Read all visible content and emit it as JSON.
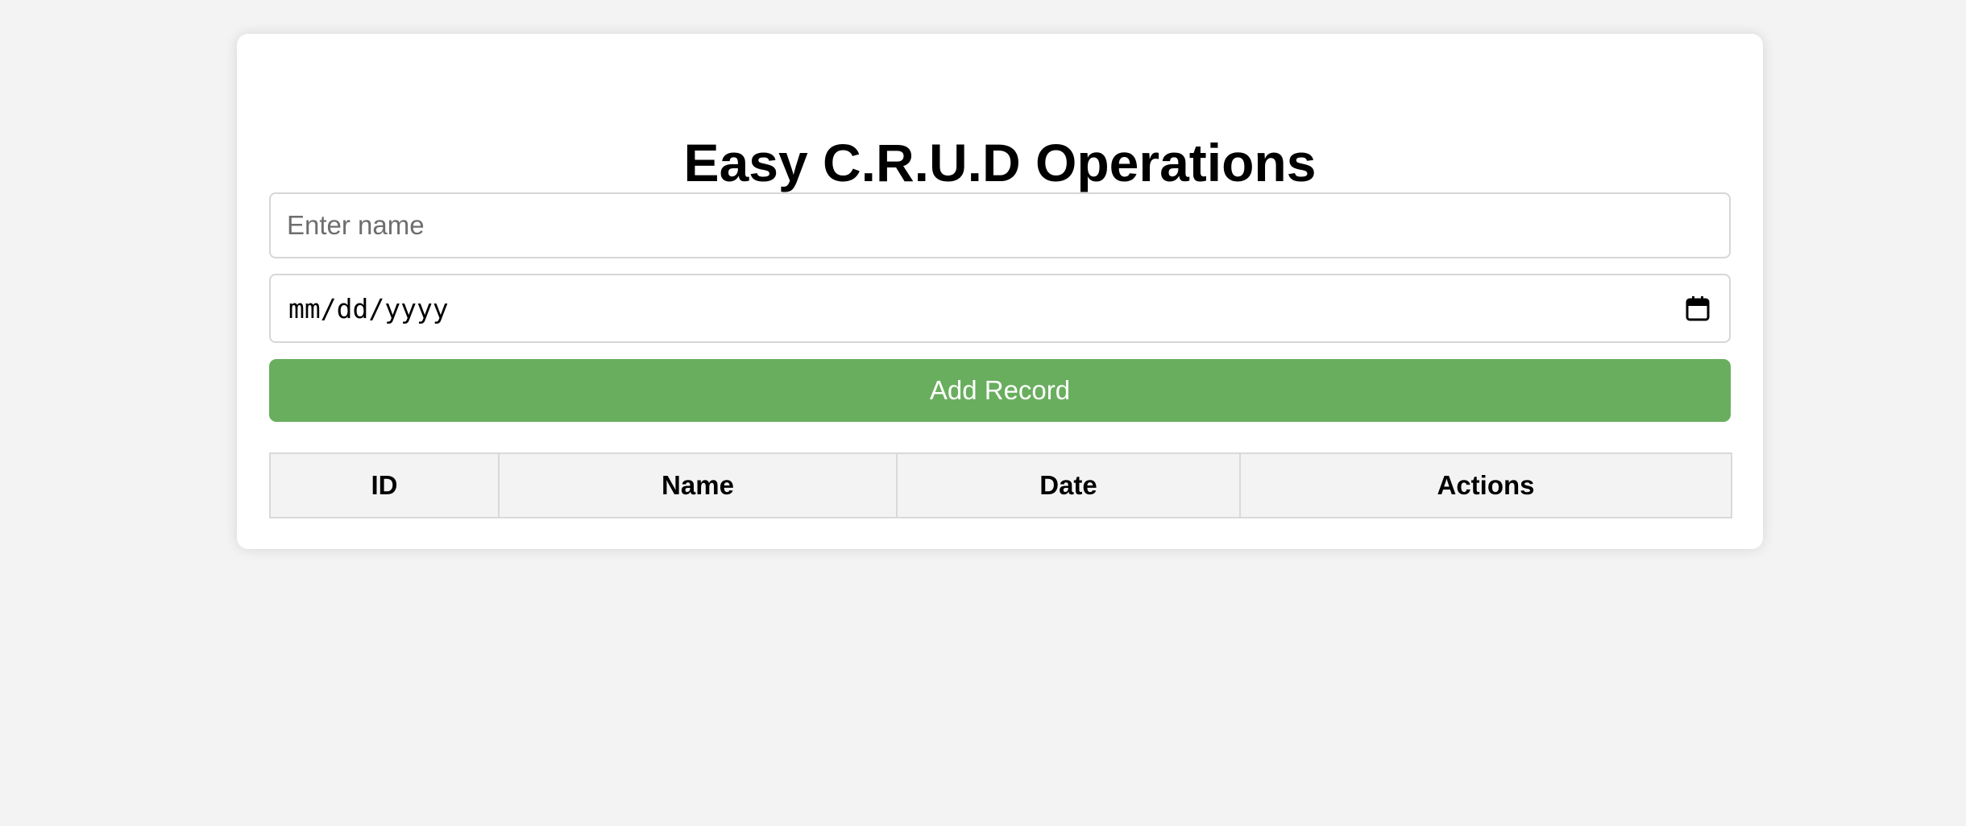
{
  "page": {
    "title": "Easy C.R.U.D Operations"
  },
  "form": {
    "name_input": {
      "value": "",
      "placeholder": "Enter name"
    },
    "date_input": {
      "value": "",
      "placeholder": "mm/dd/yyyy",
      "icon": "calendar-icon"
    },
    "add_button_label": "Add Record"
  },
  "table": {
    "columns": [
      "ID",
      "Name",
      "Date",
      "Actions"
    ],
    "rows": []
  },
  "colors": {
    "background": "#f3f3f3",
    "card": "#ffffff",
    "accent_button": "#69ae5e",
    "header_cell": "#f3f3f3",
    "border": "#d9d9d9"
  }
}
